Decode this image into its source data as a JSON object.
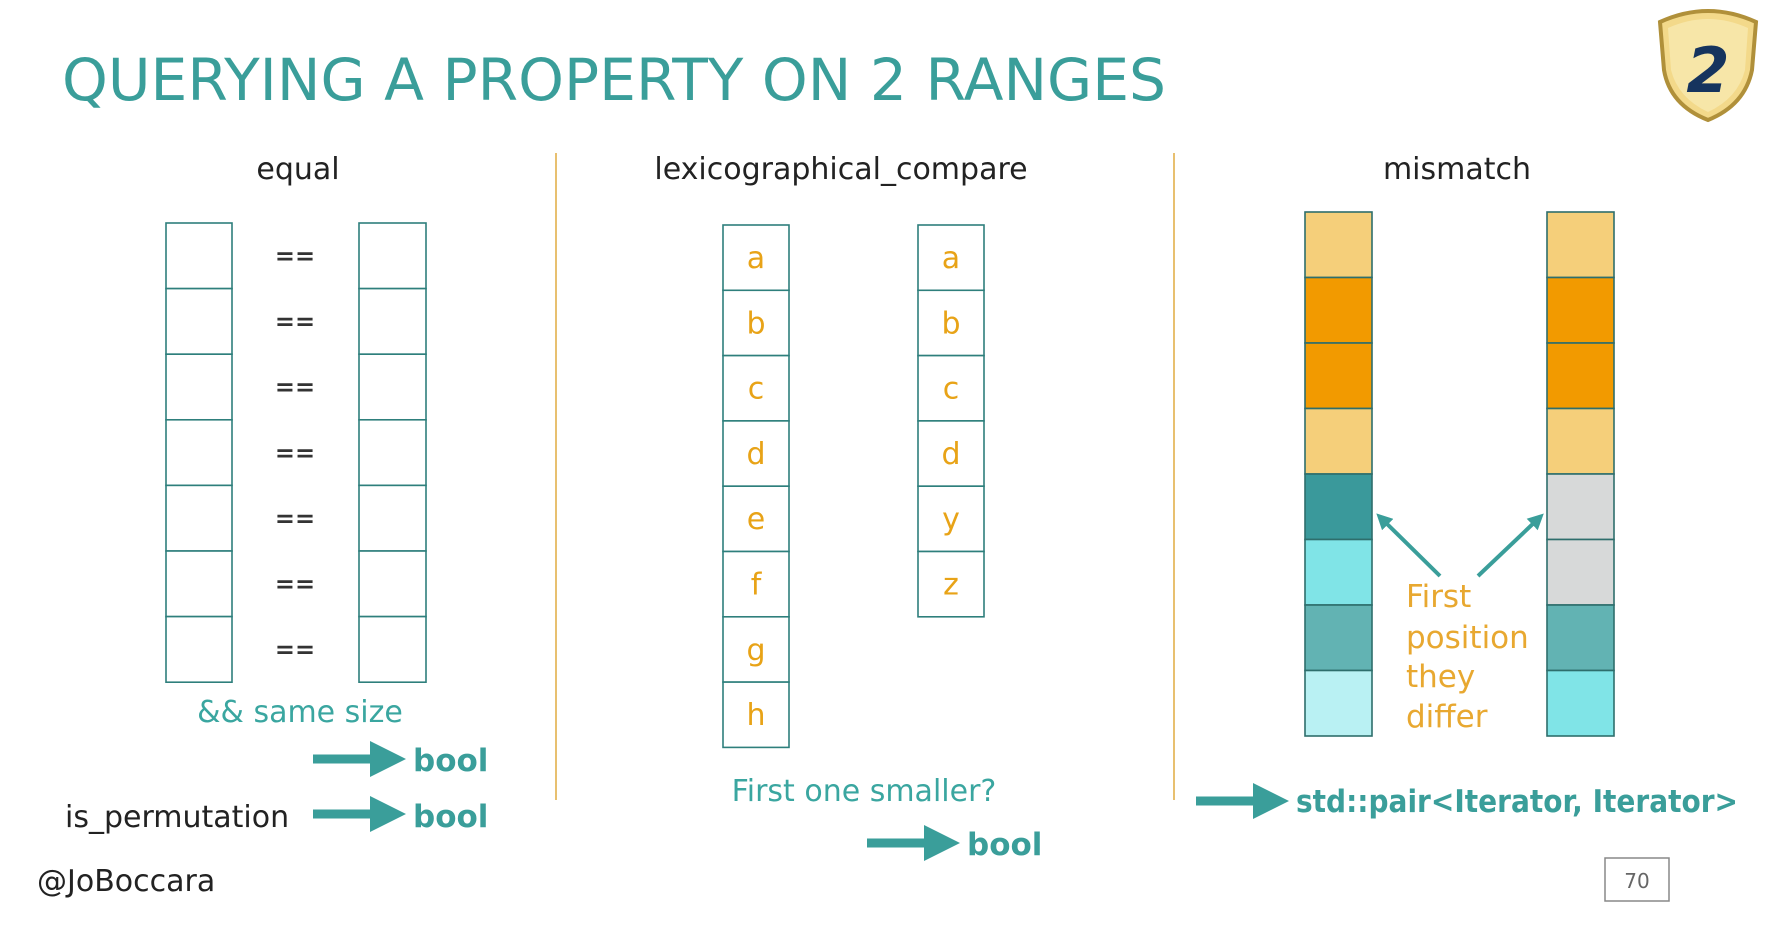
{
  "slide": {
    "title": "QUERYING A PROPERTY ON 2 RANGES",
    "author": "@JoBoccara",
    "page_number": "70",
    "logo_text": "2"
  },
  "equal": {
    "heading": "equal",
    "operator": "==",
    "rows": 7,
    "condition": "&& same size",
    "result": "bool",
    "permutation_label": "is_permutation",
    "permutation_result": "bool"
  },
  "lex": {
    "heading": "lexicographical_compare",
    "left": [
      "a",
      "b",
      "c",
      "d",
      "e",
      "f",
      "g",
      "h"
    ],
    "right": [
      "a",
      "b",
      "c",
      "d",
      "y",
      "z"
    ],
    "question": "First one smaller?",
    "result": "bool"
  },
  "mismatch": {
    "heading": "mismatch",
    "left_colors": [
      "#f5cf7a",
      "#f29a00",
      "#f29a00",
      "#f5cf7a",
      "#3a999b",
      "#80e4e7",
      "#62b3b3",
      "#b9f1f3"
    ],
    "right_colors": [
      "#f5cf7a",
      "#f29a00",
      "#f29a00",
      "#f5cf7a",
      "#d7d9d9",
      "#d7d9d9",
      "#62b3b3",
      "#80e4e7"
    ],
    "annotation": [
      "First",
      "position",
      "they",
      "differ"
    ],
    "result": "std::pair<Iterator, Iterator>"
  },
  "colors": {
    "teal": "#3a9e9a",
    "orange": "#e8a317",
    "divider": "#e8c070"
  }
}
